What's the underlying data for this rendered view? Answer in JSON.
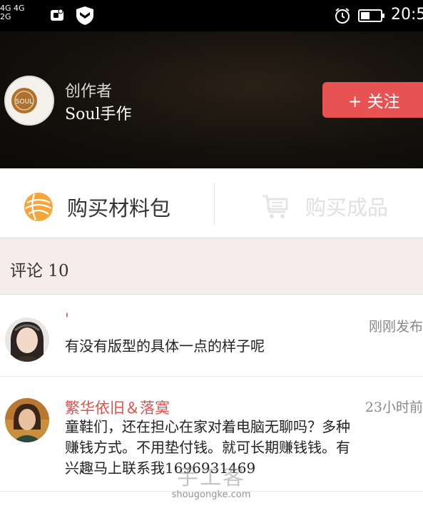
{
  "status_bar": {
    "network_top": "4G 4G",
    "network_bottom": "2G",
    "time": "20:5"
  },
  "author": {
    "role": "创作者",
    "name": "Soul手作",
    "follow_label": "+ 关注",
    "avatar_text": "SOUL"
  },
  "purchase": {
    "kit_label": "购买材料包",
    "product_label": "购买成品"
  },
  "comments": {
    "title": "评论 10",
    "items": [
      {
        "user": "'",
        "time": "刚刚发布",
        "text": "有没有版型的具体一点的样子呢"
      },
      {
        "user": "繁华依旧＆落寞",
        "time": "23小时前",
        "text": "童鞋们，还在担心在家对着电脑无聊吗？多种赚钱方式。不用垫付钱。就可长期赚钱钱。有兴趣马上联系我1696931469"
      }
    ]
  },
  "watermark": {
    "cn": "手工客",
    "en": "shougongke.com"
  },
  "colors": {
    "accent": "#e75252",
    "username": "#d9534f",
    "comments_header_bg": "#f6eceb"
  }
}
